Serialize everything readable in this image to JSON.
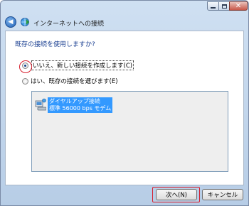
{
  "window": {
    "title": "インターネットへの接続",
    "controls": [
      "minimize-icon",
      "maximize-icon",
      "close-icon"
    ]
  },
  "content": {
    "question": "既存の接続を使用しますか?",
    "options": [
      {
        "label": "いいえ、新しい接続を作成します(C)",
        "selected": true
      },
      {
        "label": "はい、既存の接続を選びます(E)",
        "selected": false
      }
    ],
    "connections": [
      {
        "name": "ダイヤルアップ接続",
        "detail": "標準 56000 bps モデム",
        "selected": true
      }
    ]
  },
  "buttons": {
    "next": "次へ(N)",
    "cancel": "キャンセル"
  },
  "colors": {
    "heading": "#1a3f91",
    "highlight": "#d61e2d",
    "selection": "#3399ff"
  }
}
